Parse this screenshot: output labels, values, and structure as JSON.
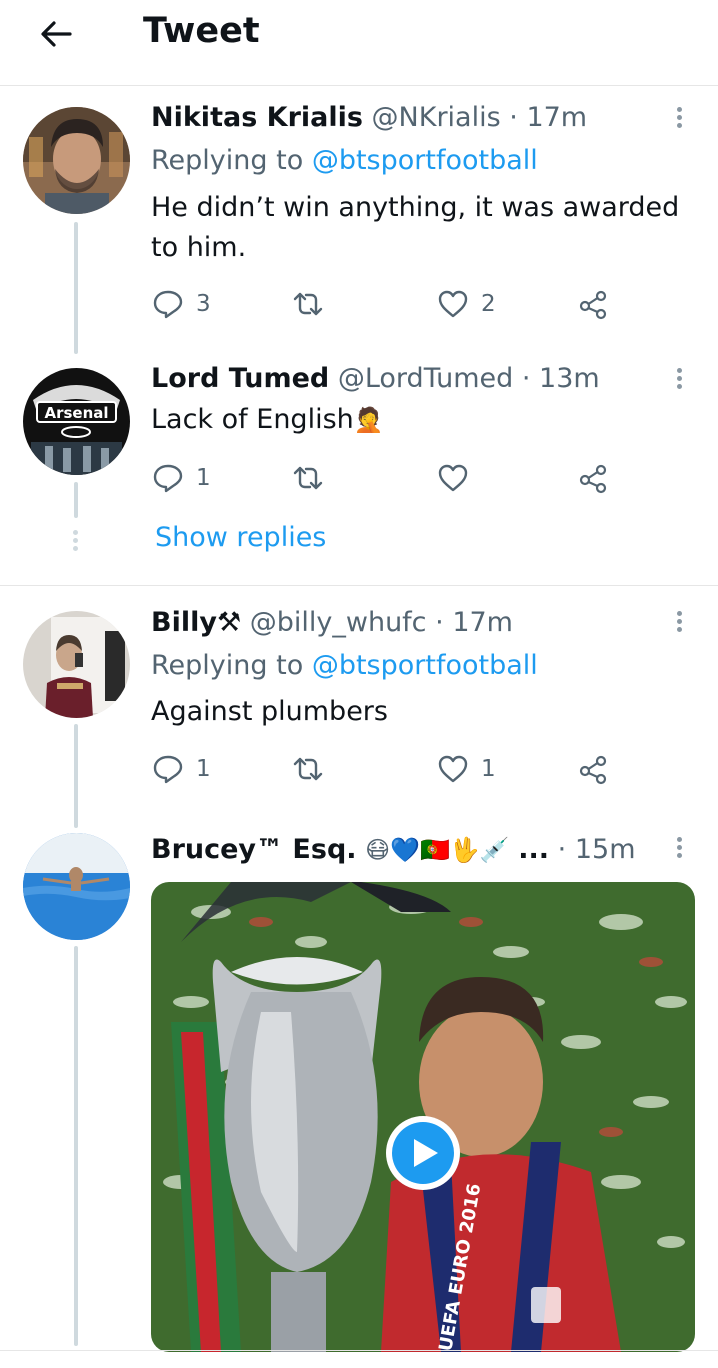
{
  "header": {
    "title": "Tweet"
  },
  "tweets": [
    {
      "name": "Nikitas Krialis",
      "handle": "@NKrialis",
      "time": "17m",
      "replying_label": "Replying to",
      "replying_to": "@btsportfootball",
      "text": "He didn’t win anything, it was awarded to him.",
      "replies": "3",
      "retweets": "",
      "likes": "2"
    },
    {
      "name": "Lord Tumed",
      "handle": "@LordTumed",
      "time": "13m",
      "text": "Lack of English",
      "emoji": "🤦",
      "avatar_text": "Arsenal",
      "replies": "1",
      "retweets": "",
      "likes": ""
    },
    {
      "name": "Billy⚒",
      "handle": "@billy_whufc",
      "time": "17m",
      "replying_label": "Replying to",
      "replying_to": "@btsportfootball",
      "text": "Against plumbers",
      "replies": "1",
      "retweets": "",
      "likes": "1"
    },
    {
      "name": "Brucey™ Esq.",
      "name_emojis": "😷💙🇵🇹🖖💉",
      "ellipsis": "...",
      "time": "15m",
      "media_caption": "UEFA EURO 2016"
    }
  ],
  "show_replies": "Show replies",
  "separator": "·",
  "colors": {
    "link": "#1d9bf0",
    "secondary": "#536471",
    "text": "#0f1419",
    "thread_line": "#cfd9de"
  },
  "icons": [
    "back-arrow-icon",
    "reply-icon",
    "retweet-icon",
    "like-icon",
    "share-icon",
    "more-icon",
    "play-icon"
  ]
}
